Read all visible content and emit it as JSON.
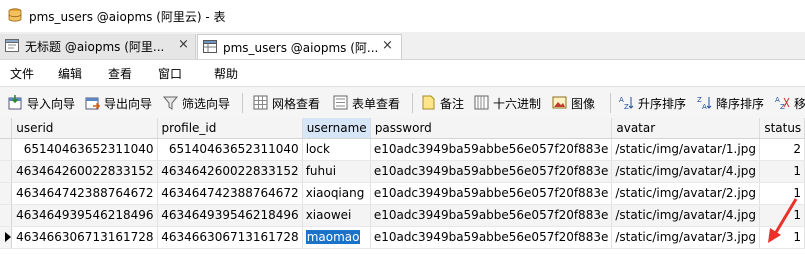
{
  "window": {
    "title": "pms_users @aiopms (阿里云) - 表"
  },
  "tabs": [
    {
      "label": "无标题 @aiopms (阿里...",
      "close": "×"
    },
    {
      "label": "pms_users @aiopms (阿...",
      "close": "×"
    }
  ],
  "menu": {
    "file": "文件",
    "edit": "编辑",
    "view": "查看",
    "window": "窗口",
    "help": "帮助"
  },
  "toolbar": {
    "import": "导入向导",
    "export": "导出向导",
    "filter": "筛选向导",
    "grid_view": "网格查看",
    "form_view": "表单查看",
    "memo": "备注",
    "hex": "十六进制",
    "image": "图像",
    "sort_asc": "升序排序",
    "sort_desc": "降序排序",
    "remove_sort": "移"
  },
  "table": {
    "columns": [
      "userid",
      "profile_id",
      "username",
      "password",
      "avatar",
      "status"
    ],
    "rows": [
      [
        "65140463652311040",
        "65140463652311040",
        "lock",
        "e10adc3949ba59abbe56e057f20f883e",
        "/static/img/avatar/1.jpg",
        "2"
      ],
      [
        "463464260022833152",
        "463464260022833152",
        "fuhui",
        "e10adc3949ba59abbe56e057f20f883e",
        "/static/img/avatar/4.jpg",
        "1"
      ],
      [
        "463464742388764672",
        "463464742388764672",
        "xiaoqiang",
        "e10adc3949ba59abbe56e057f20f883e",
        "/static/img/avatar/2.jpg",
        "1"
      ],
      [
        "463464939546218496",
        "463464939546218496",
        "xiaowei",
        "e10adc3949ba59abbe56e057f20f883e",
        "/static/img/avatar/4.jpg",
        "1"
      ],
      [
        "463466306713161728",
        "463466306713161728",
        "maomao",
        "e10adc3949ba59abbe56e057f20f883e",
        "/static/img/avatar/3.jpg",
        "1"
      ]
    ]
  }
}
